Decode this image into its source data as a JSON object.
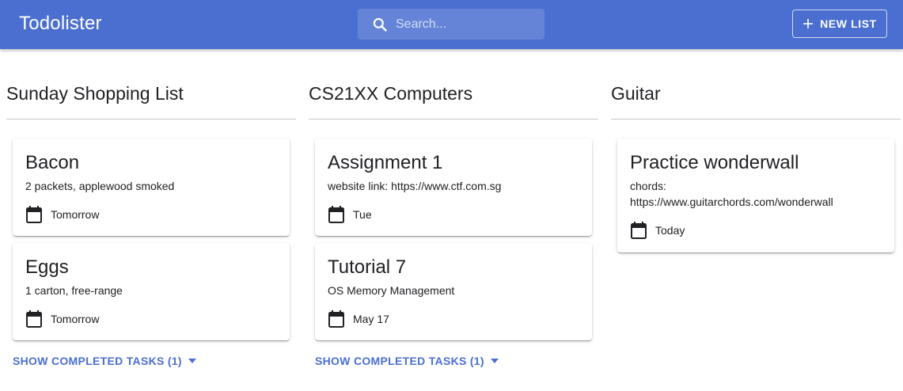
{
  "app": {
    "title": "Todolister"
  },
  "search": {
    "placeholder": "Search..."
  },
  "toolbar": {
    "new_list_label": "NEW LIST"
  },
  "colors": {
    "primary": "#4a6fd0",
    "surface": "#ffffff",
    "text": "#202124"
  },
  "lists": [
    {
      "title": "Sunday Shopping List",
      "tasks": [
        {
          "title": "Bacon",
          "description": "2 packets, applewood smoked",
          "due": "Tomorrow"
        },
        {
          "title": "Eggs",
          "description": "1 carton, free-range",
          "due": "Tomorrow"
        }
      ],
      "show_completed_label": "SHOW COMPLETED TASKS (1)"
    },
    {
      "title": "CS21XX Computers",
      "tasks": [
        {
          "title": "Assignment 1",
          "description": "website link: https://www.ctf.com.sg",
          "due": "Tue"
        },
        {
          "title": "Tutorial 7",
          "description": "OS Memory Management",
          "due": "May 17"
        }
      ],
      "show_completed_label": "SHOW COMPLETED TASKS (1)"
    },
    {
      "title": "Guitar",
      "tasks": [
        {
          "title": "Practice wonderwall",
          "description": "chords: https://www.guitarchords.com/wonderwall",
          "due": "Today"
        }
      ]
    }
  ]
}
